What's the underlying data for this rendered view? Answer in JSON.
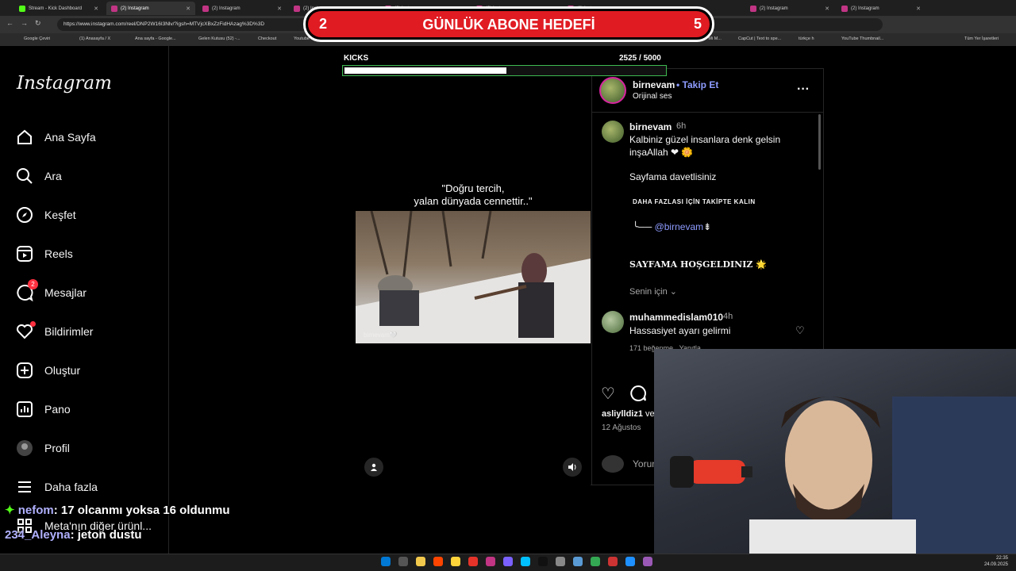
{
  "browser": {
    "tabs": [
      {
        "label": "Stream - Kick Dashboard",
        "kind": "kick"
      },
      {
        "label": "(2) Instagram",
        "kind": "instagram",
        "active": true
      },
      {
        "label": "(2) Instagram",
        "kind": "instagram"
      },
      {
        "label": "(2) Instagram",
        "kind": "instagram"
      },
      {
        "label": "(2) Instagram",
        "kind": "instagram"
      },
      {
        "label": "(2) Instagram",
        "kind": "instagram"
      },
      {
        "label": "(2) Instagram",
        "kind": "instagram"
      },
      {
        "label": "(2) Instagram",
        "kind": "instagram"
      },
      {
        "label": "(2) Instagram",
        "kind": "instagram"
      }
    ],
    "url": "https://www.instagram.com/reel/DNP2W16I3Nlv/?igsh=MTVjcXBxZzFidHAzag%3D%3D",
    "bookmarks": [
      "Google Çeviri",
      "(1) Anasayfa / X",
      "Ana sayfa - Google...",
      "Gelen Kutusu (52) -...",
      "Checkout",
      "Youtube",
      "Kick",
      "ChatGPT",
      "Esperanza000 Strea...",
      "The best ChatBot ap...",
      "Ino Örnek",
      "Ravaccanli \"Mi M...",
      "CapCut | Text to spe...",
      "türkçe h",
      "YouTube Thumbnail...",
      "Tüm Yer İşaretleri"
    ]
  },
  "sidebar": {
    "logo": "Instagram",
    "items": [
      {
        "label": "Ana Sayfa",
        "icon": "home-icon"
      },
      {
        "label": "Ara",
        "icon": "search-icon"
      },
      {
        "label": "Keşfet",
        "icon": "compass-icon"
      },
      {
        "label": "Reels",
        "icon": "reels-icon"
      },
      {
        "label": "Mesajlar",
        "icon": "messenger-icon",
        "badge": "2"
      },
      {
        "label": "Bildirimler",
        "icon": "heart-icon"
      },
      {
        "label": "Oluştur",
        "icon": "plus-square-icon"
      },
      {
        "label": "Pano",
        "icon": "dashboard-icon"
      },
      {
        "label": "Profil",
        "icon": "avatar-icon"
      },
      {
        "label": "Daha fazla",
        "icon": "menu-icon"
      },
      {
        "label": "Meta'nın diğer ürünl...",
        "icon": "grid-icon"
      }
    ]
  },
  "goal": {
    "current": "2",
    "title": "GÜNLÜK ABONE HEDEFİ",
    "target": "5"
  },
  "kicks": {
    "label": "KICKS",
    "count": "2525  / 5000",
    "progress": 0.505
  },
  "post": {
    "quote_line1": "\"Doğru tercih,",
    "quote_line2": "yalan dünyada cennettir..\"",
    "watermark": "birnevam🤍",
    "author": "birnevam",
    "follow": "• Takip Et",
    "audio": "Orijinal ses",
    "caption_user": "birnevam",
    "caption_time": "6h",
    "caption_line1": "Kalbiniz güzel insanlara denk gelsin",
    "caption_line2": "inşaAllah ❤ 🌼",
    "caption_line3": "Sayfama davetlisiniz",
    "caption_line4": "DAHA FAZLASI İÇİN TAKİPTE KALIN",
    "caption_line5_prefix": "╰──",
    "caption_line5_mention": "@birnevam",
    "caption_line5_suffix": "⇟",
    "caption_line6": "SAYFAMA HOŞGELDINIZ",
    "caption_line6_icon": "🌟",
    "translation": "Senin için",
    "comment_user": "muhammedislam010",
    "comment_time": "4h",
    "comment_text": "Hassasiyet ayarı gelirmi",
    "comment_likes": "171 beğenme",
    "comment_reply": "Yanıtla",
    "likes_prefix": "asliylldiz1",
    "likes_suffix": "ve",
    "date": "12 Ağustos",
    "comment_placeholder": "Yorum"
  },
  "chat": [
    {
      "user": "nefom",
      "message": ": 17 olcanmı yoksa 16 oldunmu"
    },
    {
      "user": "234_Aleyna",
      "message": ": jeton dustu"
    }
  ],
  "clock": {
    "time": "22:35",
    "date": "24.09.2025"
  }
}
